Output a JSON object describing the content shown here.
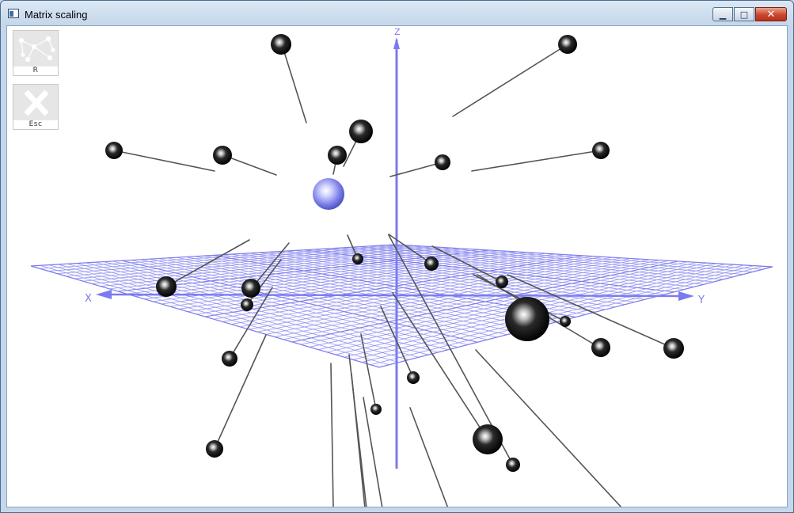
{
  "window": {
    "title": "Matrix scaling",
    "minimize_glyph": "▁",
    "maximize_glyph": "□",
    "close_glyph": "✕"
  },
  "toolbar": {
    "randomize_label": "R",
    "exit_label": "Esc"
  },
  "axes": {
    "x_label": "X",
    "y_label": "Y",
    "z_label": "Z",
    "axis_color": "#7b7bf0"
  },
  "colors": {
    "highlight_sphere": "#b8bcff",
    "sphere": "#111111",
    "line": "#444444"
  }
}
